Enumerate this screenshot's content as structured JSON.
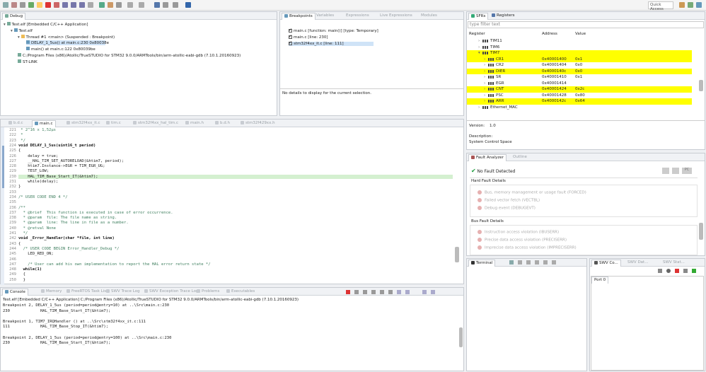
{
  "toolbar": {
    "quick_access": "Quick Access"
  },
  "debug": {
    "tab": "Debug",
    "tree": [
      "Test.elf [Embedded C/C++ Application]",
      "Test.elf",
      "Thread #1 <main> (Suspended : Breakpoint)",
      "DELAY_1_5us() at main.c:230 0x80038e",
      "main() at main.c:122 0x80039be",
      "C:/Program Files (x86)/Atollic/TrueSTUDIO for STM32 9.0.0/ARMTools/bin/arm-atollic-eabi-gdb (7.10.1.20160923)",
      "ST-LINK"
    ]
  },
  "breakpoints": {
    "tabs": [
      "Breakpoints",
      "Variables",
      "Expressions",
      "Live Expressions",
      "Modules"
    ],
    "items": [
      "main.c [function: main()] [type: Temporary]",
      "main.c [line: 230]",
      "stm32f4xx_it.c [line: 111]"
    ],
    "detail": "No details to display for the current selection."
  },
  "sfrs": {
    "tabs": [
      "SFRs",
      "Registers"
    ],
    "filter_placeholder": "type filter text",
    "columns": [
      "Register",
      "Address",
      "Value"
    ],
    "rows": [
      {
        "name": "TIM11",
        "address": "",
        "value": "",
        "highlight": false,
        "indent": 1
      },
      {
        "name": "TIM6",
        "address": "",
        "value": "",
        "highlight": false,
        "indent": 1
      },
      {
        "name": "TIM7",
        "address": "",
        "value": "",
        "highlight": true,
        "indent": 1
      },
      {
        "name": "CR1",
        "address": "0x40001400",
        "value": "0x1",
        "highlight": true,
        "indent": 2
      },
      {
        "name": "CR2",
        "address": "0x40001404",
        "value": "0x0",
        "highlight": false,
        "indent": 2
      },
      {
        "name": "DIER",
        "address": "0x4000140c",
        "value": "0x0",
        "highlight": true,
        "indent": 2
      },
      {
        "name": "SR",
        "address": "0x40001410",
        "value": "0x1",
        "highlight": false,
        "indent": 2
      },
      {
        "name": "EGR",
        "address": "0x40001414",
        "value": "",
        "highlight": false,
        "indent": 2
      },
      {
        "name": "CNT",
        "address": "0x40001424",
        "value": "0x2c",
        "highlight": true,
        "indent": 2
      },
      {
        "name": "PSC",
        "address": "0x40001428",
        "value": "0x80",
        "highlight": false,
        "indent": 2
      },
      {
        "name": "ARR",
        "address": "0x4000142c",
        "value": "0x64",
        "highlight": true,
        "indent": 2
      },
      {
        "name": "Ethernet_MAC",
        "address": "",
        "value": "",
        "highlight": false,
        "indent": 1
      }
    ],
    "version_label": "Version:",
    "version_value": "1.0",
    "description_label": "Description:",
    "description_value": "System Control Space"
  },
  "editor": {
    "tabs": [
      "b.d.c",
      "main.c",
      "stm32f4xx_it.c",
      "tim.c",
      "stm32f4xx_hal_tim.c",
      "main.h",
      "b.d.h",
      "stm32f429xx.h"
    ],
    "lines": [
      {
        "n": "221",
        "t": " * 2^16 x 1,52µs",
        "c": "cm"
      },
      {
        "n": "222",
        "t": " *",
        "c": "cm"
      },
      {
        "n": "223",
        "t": " */",
        "c": "cm"
      },
      {
        "n": "224",
        "t": "void DELAY_1_5us(uint16_t period)",
        "c": "kw1"
      },
      {
        "n": "225",
        "t": "{",
        "c": ""
      },
      {
        "n": "226",
        "t": "    delay = true;",
        "c": ""
      },
      {
        "n": "227",
        "t": "    __HAL_TIM_SET_AUTORELOAD(&htim7, period);",
        "c": ""
      },
      {
        "n": "228",
        "t": "    htim7.Instance->EGR = TIM_EGR_UG;",
        "c": ""
      },
      {
        "n": "229",
        "t": "    TEST_LOW;",
        "c": ""
      },
      {
        "n": "230",
        "t": "    HAL_TIM_Base_Start_IT(&htim7);",
        "c": "hl"
      },
      {
        "n": "231",
        "t": "    while(delay);",
        "c": ""
      },
      {
        "n": "232",
        "t": "}",
        "c": ""
      },
      {
        "n": "233",
        "t": "",
        "c": ""
      },
      {
        "n": "234",
        "t": "/* USER CODE END 4 */",
        "c": "cm"
      },
      {
        "n": "235",
        "t": "",
        "c": ""
      },
      {
        "n": "236",
        "t": "/**",
        "c": "cm"
      },
      {
        "n": "237",
        "t": "  * @brief  This function is executed in case of error occurrence.",
        "c": "cm"
      },
      {
        "n": "238",
        "t": "  * @param  file: The file name as string.",
        "c": "cm"
      },
      {
        "n": "239",
        "t": "  * @param  line: The line in file as a number.",
        "c": "cm"
      },
      {
        "n": "240",
        "t": "  * @retval None",
        "c": "cm"
      },
      {
        "n": "241",
        "t": "  */",
        "c": "cm"
      },
      {
        "n": "242",
        "t": "void _Error_Handler(char *file, int line)",
        "c": "kw1"
      },
      {
        "n": "243",
        "t": "{",
        "c": ""
      },
      {
        "n": "244",
        "t": "  /* USER CODE BEGIN Error_Handler_Debug */",
        "c": "cm"
      },
      {
        "n": "245",
        "t": "    LED_RED_ON;",
        "c": ""
      },
      {
        "n": "246",
        "t": "",
        "c": ""
      },
      {
        "n": "247",
        "t": "    /* User can add his own implementation to report the HAL error return state */",
        "c": "cm"
      },
      {
        "n": "248",
        "t": "  while(1)",
        "c": "kw2"
      },
      {
        "n": "249",
        "t": "  {",
        "c": ""
      },
      {
        "n": "250",
        "t": "  }",
        "c": ""
      }
    ]
  },
  "console": {
    "tabs": [
      "Console",
      "Memory",
      "FreeRTOS Task List",
      "SWV Trace Log",
      "SWV Exception Trace Log",
      "Problems",
      "Executables"
    ],
    "header": "Test.elf [Embedded C/C++ Application] C:/Program Files (x86)/Atollic/TrueSTUDIO for STM32 9.0.0/ARMTools/bin/arm-atollic-eabi-gdb (7.10.1.20160923)",
    "lines": [
      "Breakpoint 2, DELAY_1_5us (period=period@entry=10) at ..\\Src\\main.c:230",
      "230             HAL_TIM_Base_Start_IT(&htim7);",
      "",
      "Breakpoint 1, TIM7_IRQHandler () at ..\\Src\\stm32f4xx_it.c:111",
      "111             HAL_TIM_Base_Stop_IT(&htim7);",
      "",
      "Breakpoint 2, DELAY_1_5us (period=period@entry=100) at ..\\Src\\main.c:230",
      "230             HAL_TIM_Base_Start_IT(&htim7);"
    ]
  },
  "fault": {
    "tabs": [
      "Fault Analyzer",
      "Outline"
    ],
    "status": "No Fault Detected",
    "hard_title": "Hard Fault Details",
    "hard_items": [
      "Bus, memory management or usage fault (FORCED)",
      "Failed vector fetch (VECTBL)",
      "Debug event (DEBUGEVT)"
    ],
    "bus_title": "Bus Fault Details",
    "bus_items": [
      "Instruction access violation (IBUSERR)",
      "Precise data access violation (PRECISERR)",
      "Imprecise data access violation (IMPRECISERR)"
    ],
    "buttons": [
      "PC"
    ]
  },
  "terminal": {
    "tab": "Terminal"
  },
  "swv": {
    "tabs": [
      "SWV Co...",
      "SWV Dat...",
      "SWV Stat..."
    ],
    "port": "Port 0"
  }
}
